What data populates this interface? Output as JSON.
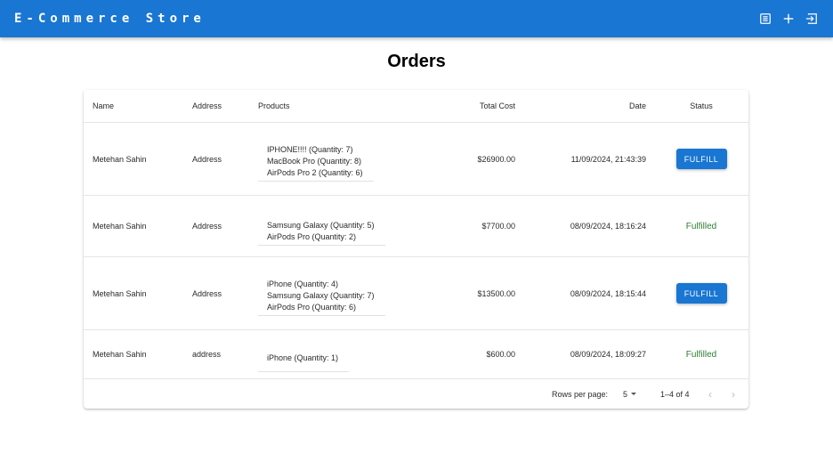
{
  "appbar": {
    "title": "E-Commerce Store",
    "icons": [
      "orders-list-icon",
      "add-icon",
      "logout-icon"
    ]
  },
  "page": {
    "title": "Orders"
  },
  "table": {
    "headers": {
      "name": "Name",
      "address": "Address",
      "products": "Products",
      "total": "Total Cost",
      "date": "Date",
      "status": "Status"
    },
    "rows": [
      {
        "name": "Metehan Sahin",
        "address": "Address",
        "products": [
          "IPHONE!!!! (Quantity: 7)",
          "MacBook Pro (Quantity: 8)",
          "AirPods Pro 2 (Quantity: 6)"
        ],
        "total": "$26900.00",
        "date": "11/09/2024, 21:43:39",
        "status": "FULFILL"
      },
      {
        "name": "Metehan Sahin",
        "address": "Address",
        "products": [
          "Samsung Galaxy (Quantity: 5)",
          "AirPods Pro (Quantity: 2)"
        ],
        "total": "$7700.00",
        "date": "08/09/2024, 18:16:24",
        "status": "Fulfilled"
      },
      {
        "name": "Metehan Sahin",
        "address": "Address",
        "products": [
          "iPhone (Quantity: 4)",
          "Samsung Galaxy (Quantity: 7)",
          "AirPods Pro (Quantity: 6)"
        ],
        "total": "$13500.00",
        "date": "08/09/2024, 18:15:44",
        "status": "FULFILL"
      },
      {
        "name": "Metehan Sahin",
        "address": "address",
        "products": [
          "iPhone (Quantity: 1)"
        ],
        "total": "$600.00",
        "date": "08/09/2024, 18:09:27",
        "status": "Fulfilled"
      }
    ]
  },
  "pagination": {
    "rows_per_page_label": "Rows per page:",
    "rows_per_page_value": "5",
    "range_label": "1–4 of 4",
    "prev_glyph": "‹",
    "next_glyph": "›"
  },
  "colors": {
    "primary": "#1976d2",
    "fulfilled": "#2e7d32"
  }
}
